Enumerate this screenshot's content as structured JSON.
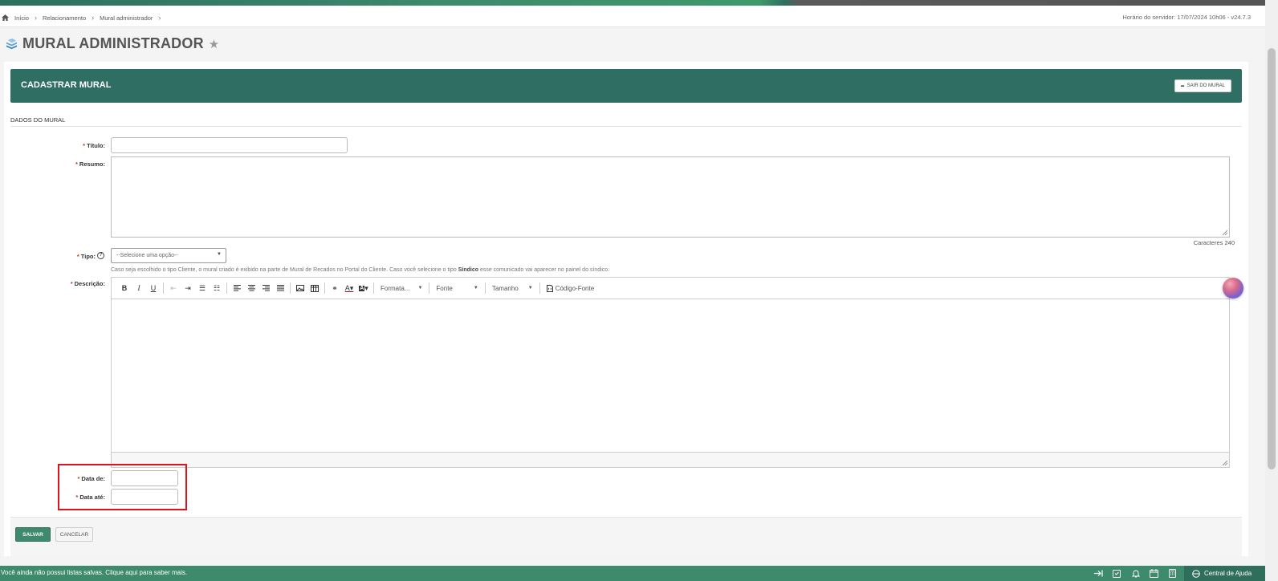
{
  "breadcrumb": {
    "items": [
      "Início",
      "Relacionamento",
      "Mural administrador"
    ],
    "server_time": "Horário do servidor: 17/07/2024 10h06 - v24.7.3"
  },
  "page": {
    "title": "MURAL ADMINISTRADOR"
  },
  "panel": {
    "header_title": "CADASTRAR MURAL",
    "exit_label": "SAIR DO MURAL",
    "section_label": "DADOS DO MURAL"
  },
  "form": {
    "titulo_label": "Título:",
    "resumo_label": "Resumo:",
    "chars_label": "Caracteres 240",
    "tipo_label": "Tipo:",
    "tipo_value": "--Selecione uma opção--",
    "tipo_hint_pre": "Caso seja escolhido o tipo Cliente, o mural criado é exibido na parte de Mural de Recados no Portal do Cliente. Caso você selecione o tipo ",
    "tipo_hint_bold": "Síndico",
    "tipo_hint_post": " esse comunicado vai aparecer no painel do síndico.",
    "descricao_label": "Descrição:",
    "data_de_label": "Data de:",
    "data_ate_label": "Data até:",
    "required_mark": "*"
  },
  "editor": {
    "format_label": "Formata...",
    "font_label": "Fonte",
    "size_label": "Tamanho",
    "source_label": "Código-Fonte"
  },
  "actions": {
    "save_label": "SALVAR",
    "cancel_label": "CANCELAR"
  },
  "bottom_bar": {
    "message": "Você ainda não possui listas salvas. Clique aqui para saber mais.",
    "help_center": "Central de Ajuda"
  },
  "colors": {
    "brand_green": "#2f6e63",
    "accent_green": "#3e8a6d",
    "highlight_red": "#e0131c"
  }
}
